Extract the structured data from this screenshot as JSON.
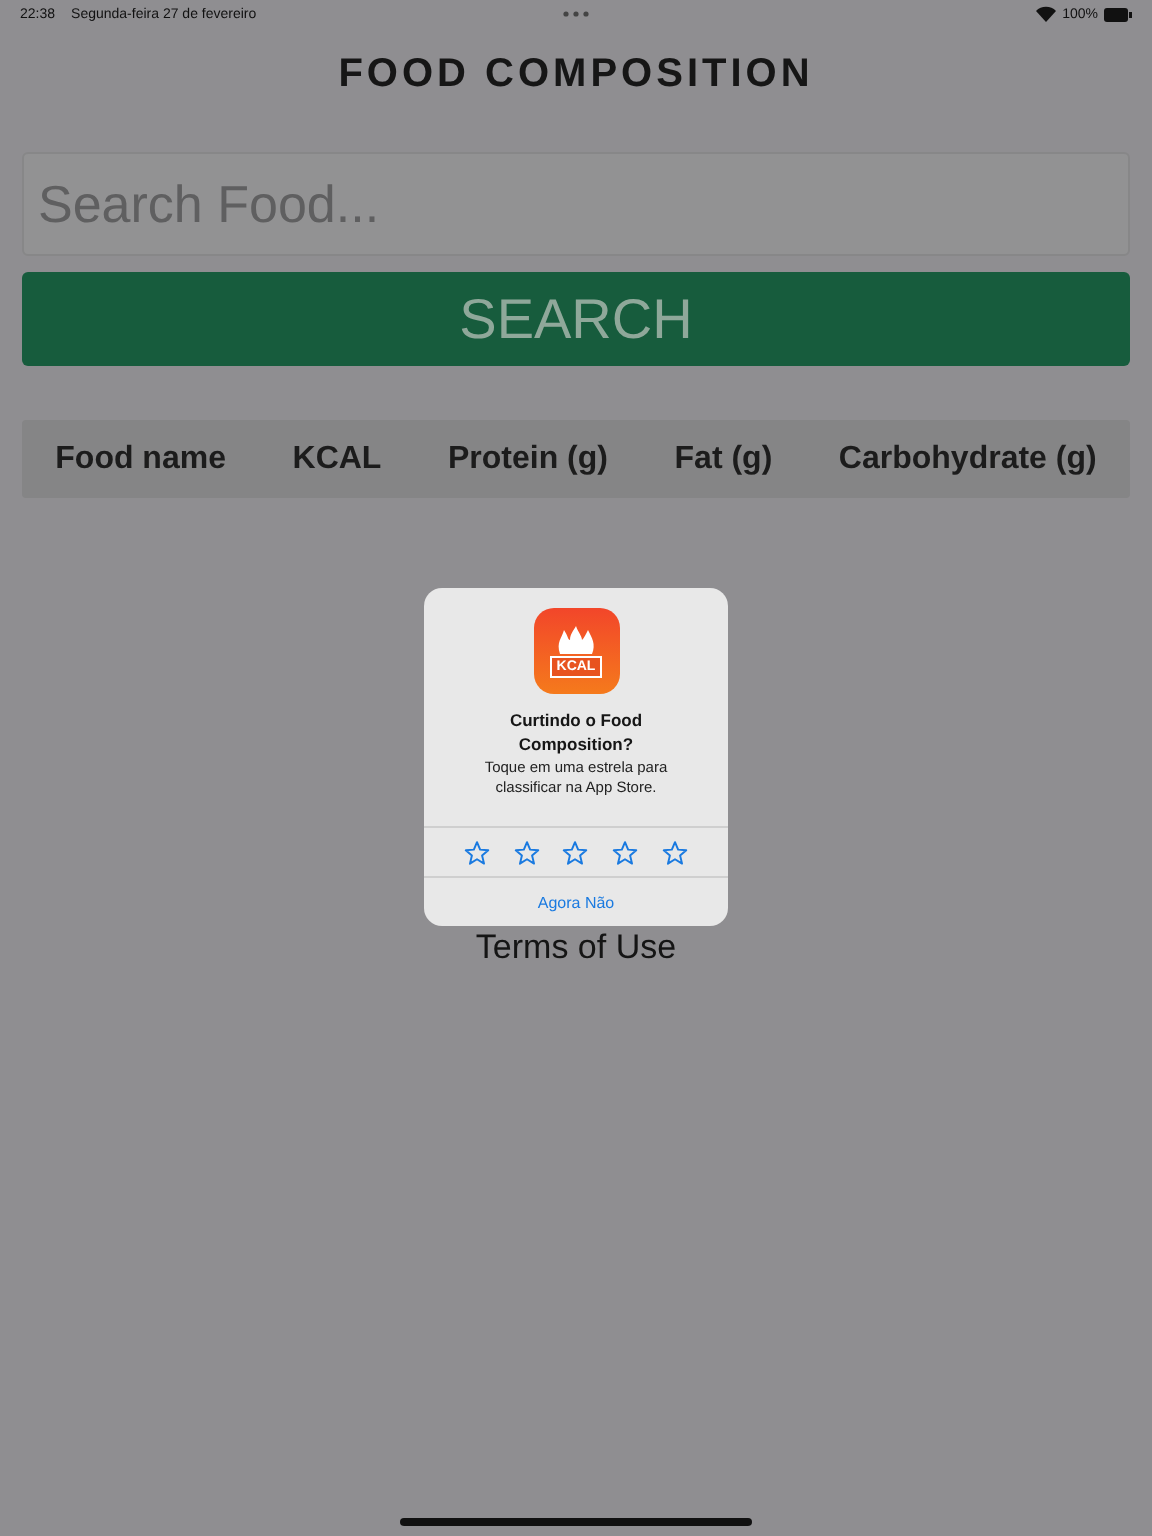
{
  "status_bar": {
    "time": "22:38",
    "date": "Segunda-feira 27 de fevereiro",
    "battery": "100%"
  },
  "title": "FOOD COMPOSITION",
  "search": {
    "placeholder": "Search Food..."
  },
  "search_button": "SEARCH",
  "table": {
    "columns": [
      "Food name",
      "KCAL",
      "Protein (g)",
      "Fat (g)",
      "Carbohydrate (g)"
    ]
  },
  "footer_link": "Terms of Use",
  "rating_dialog": {
    "app_icon_label": "KCAL",
    "title": "Curtindo o Food Composition?",
    "message": "Toque em uma estrela para classificar na App Store.",
    "stars": 0,
    "dismiss": "Agora Não"
  }
}
